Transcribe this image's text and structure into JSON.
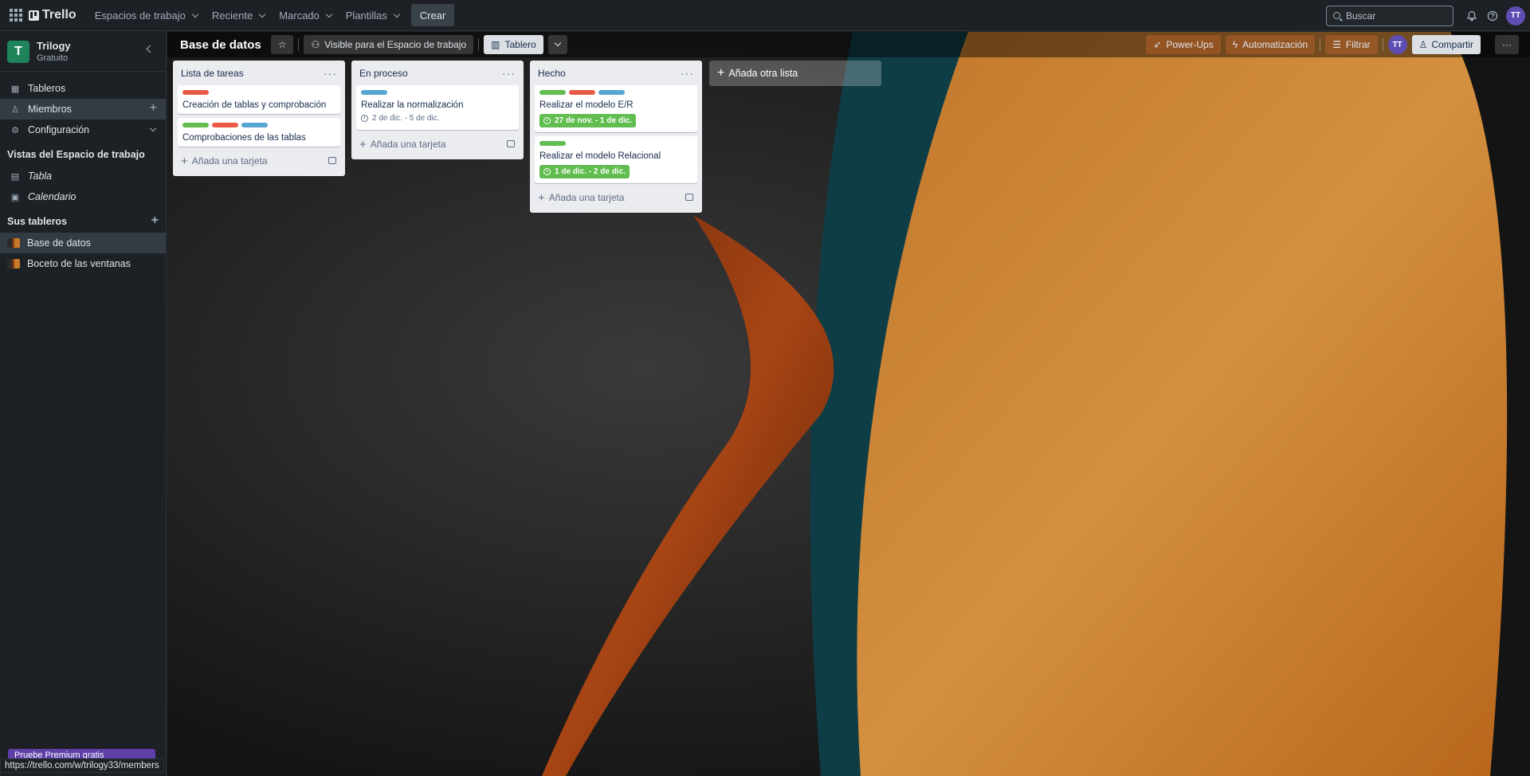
{
  "topbar": {
    "app_name": "Trello",
    "menus": [
      "Espacios de trabajo",
      "Reciente",
      "Marcado",
      "Plantillas"
    ],
    "create_label": "Crear",
    "search_placeholder": "Buscar",
    "avatar_initials": "TT"
  },
  "sidebar": {
    "workspace_initial": "T",
    "workspace_name": "Trilogy",
    "workspace_plan": "Gratuito",
    "items": [
      {
        "label": "Tableros",
        "icon": "board-icon"
      },
      {
        "label": "Miembros",
        "icon": "person-icon"
      },
      {
        "label": "Configuración",
        "icon": "gear-icon"
      }
    ],
    "views_title": "Vistas del Espacio de trabajo",
    "views": [
      {
        "label": "Tabla",
        "icon": "table-icon"
      },
      {
        "label": "Calendario",
        "icon": "calendar-icon"
      }
    ],
    "boards_title": "Sus tableros",
    "boards": [
      {
        "label": "Base de datos"
      },
      {
        "label": "Boceto de las ventanas"
      }
    ],
    "premium_label": "Pruebe Premium gratis"
  },
  "board": {
    "title": "Base de datos",
    "visibility_label": "Visible para el Espacio de trabajo",
    "view_label": "Tablero",
    "powerups_label": "Power-Ups",
    "automation_label": "Automatización",
    "filter_label": "Filtrar",
    "member_initials": "TT",
    "share_label": "Compartir",
    "add_list_label": "Añada otra lista",
    "lists": [
      {
        "title": "Lista de tareas",
        "add_card_label": "Añada una tarjeta",
        "cards": [
          {
            "labels": [
              "#eb5a46"
            ],
            "title": "Creación de tablas y comprobación",
            "date": "",
            "done": false
          },
          {
            "labels": [
              "#61bd4f",
              "#eb5a46",
              "#55a6d1"
            ],
            "title": "Comprobaciones de las tablas",
            "date": "",
            "done": false
          }
        ]
      },
      {
        "title": "En proceso",
        "add_card_label": "Añada una tarjeta",
        "cards": [
          {
            "labels": [
              "#55a6d1"
            ],
            "title": "Realizar la normalización",
            "date": "2 de dic. - 5 de dic.",
            "done": false
          }
        ]
      },
      {
        "title": "Hecho",
        "add_card_label": "Añada una tarjeta",
        "cards": [
          {
            "labels": [
              "#61bd4f",
              "#eb5a46",
              "#55a6d1"
            ],
            "title": "Realizar el modelo E/R",
            "date": "27 de nov. - 1 de dic.",
            "done": true
          },
          {
            "labels": [
              "#61bd4f"
            ],
            "title": "Realizar el modelo Relacional",
            "date": "1 de dic. - 2 de dic.",
            "done": true
          }
        ]
      }
    ]
  },
  "status_url": "https://trello.com/w/trilogy33/members"
}
